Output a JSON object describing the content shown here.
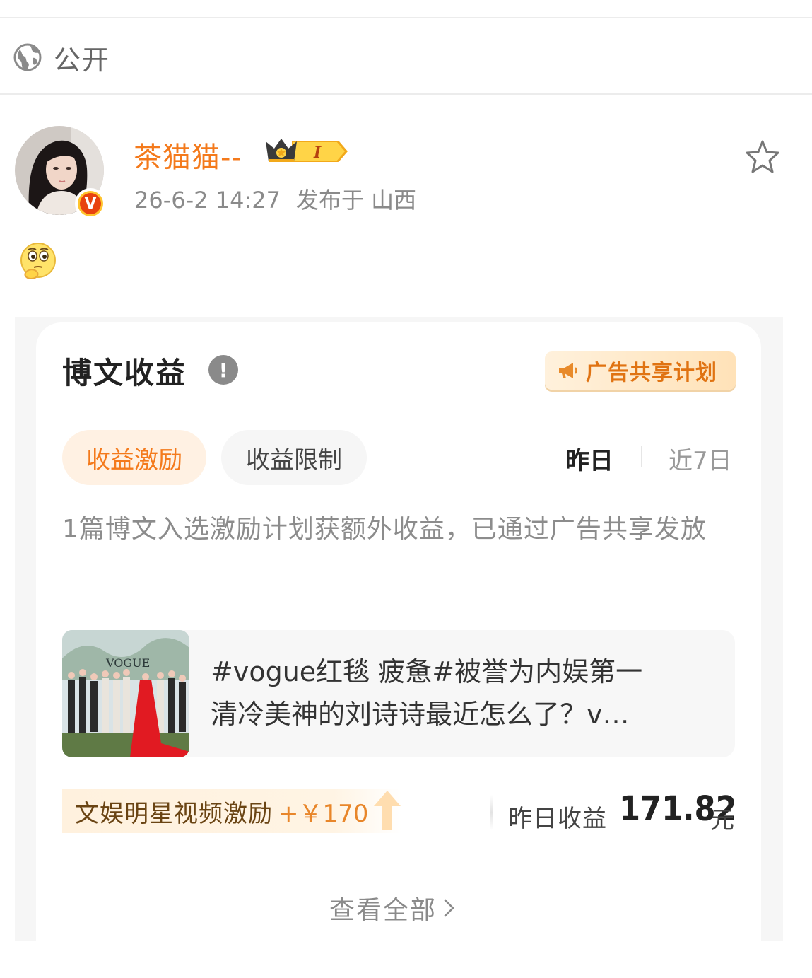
{
  "privacy": {
    "label": "公开",
    "icon": "globe-icon"
  },
  "post": {
    "author": "茶猫猫--",
    "verified_badge": "V",
    "member_level": "I",
    "timestamp": "26-6-2 14:27",
    "location": "发布于 山西",
    "emoji": "thinking-face-emoji"
  },
  "earnings_card": {
    "title": "博文收益",
    "ad_share_label": "广告共享计划",
    "tabs": [
      {
        "label": "收益激励",
        "active": true
      },
      {
        "label": "收益限制",
        "active": false
      }
    ],
    "periods": [
      {
        "label": "昨日",
        "active": true
      },
      {
        "label": "近7日",
        "active": false
      }
    ],
    "description": "1篇博文入选激励计划获额外收益，已通过广告共享发放",
    "linked_post": {
      "line1": "#vogue红毯 疲惫#被誉为内娱第一",
      "line2": "清冷美神的刘诗诗最近怎么了？v…"
    },
    "bonus": {
      "label": "文娱明星视频激励",
      "amount": "+￥170"
    },
    "yesterday_earnings": {
      "label": "昨日收益",
      "value": "171.82",
      "unit": "元"
    },
    "view_all": "查看全部"
  },
  "colors": {
    "accent_orange": "#f47a1c",
    "verified_yellow": "#ffc42e",
    "verified_red": "#e8430f",
    "muted_text": "#8a8a8a"
  }
}
